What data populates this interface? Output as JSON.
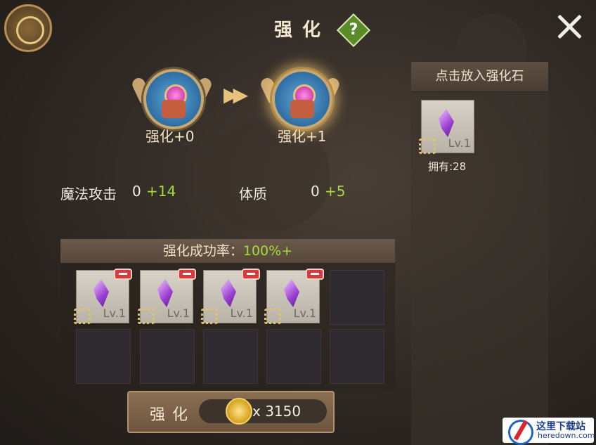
{
  "header": {
    "title": "强化",
    "help_icon": "question-icon",
    "close_icon": "close-icon"
  },
  "upgrade": {
    "from_level": "强化+0",
    "to_level": "强化+1"
  },
  "stats": [
    {
      "label": "魔法攻击",
      "base": "0",
      "bonus": "+14"
    },
    {
      "label": "体质",
      "base": "0",
      "bonus": "+5"
    }
  ],
  "rate": {
    "label": "强化成功率：",
    "value": "100%+"
  },
  "slots": {
    "filled": [
      {
        "level": "Lv.1"
      },
      {
        "level": "Lv.1"
      },
      {
        "level": "Lv.1"
      },
      {
        "level": "Lv.1"
      }
    ]
  },
  "action": {
    "label": "强化",
    "cost": "x 3150"
  },
  "inventory": {
    "header": "点击放入强化石",
    "items": [
      {
        "level": "Lv.1",
        "owned": "拥有:28"
      }
    ]
  },
  "watermark": {
    "title": "这里下载站",
    "subtitle": "heredown.com"
  },
  "colors": {
    "bonus": "#a5dc3a",
    "accent": "#c8a872"
  }
}
